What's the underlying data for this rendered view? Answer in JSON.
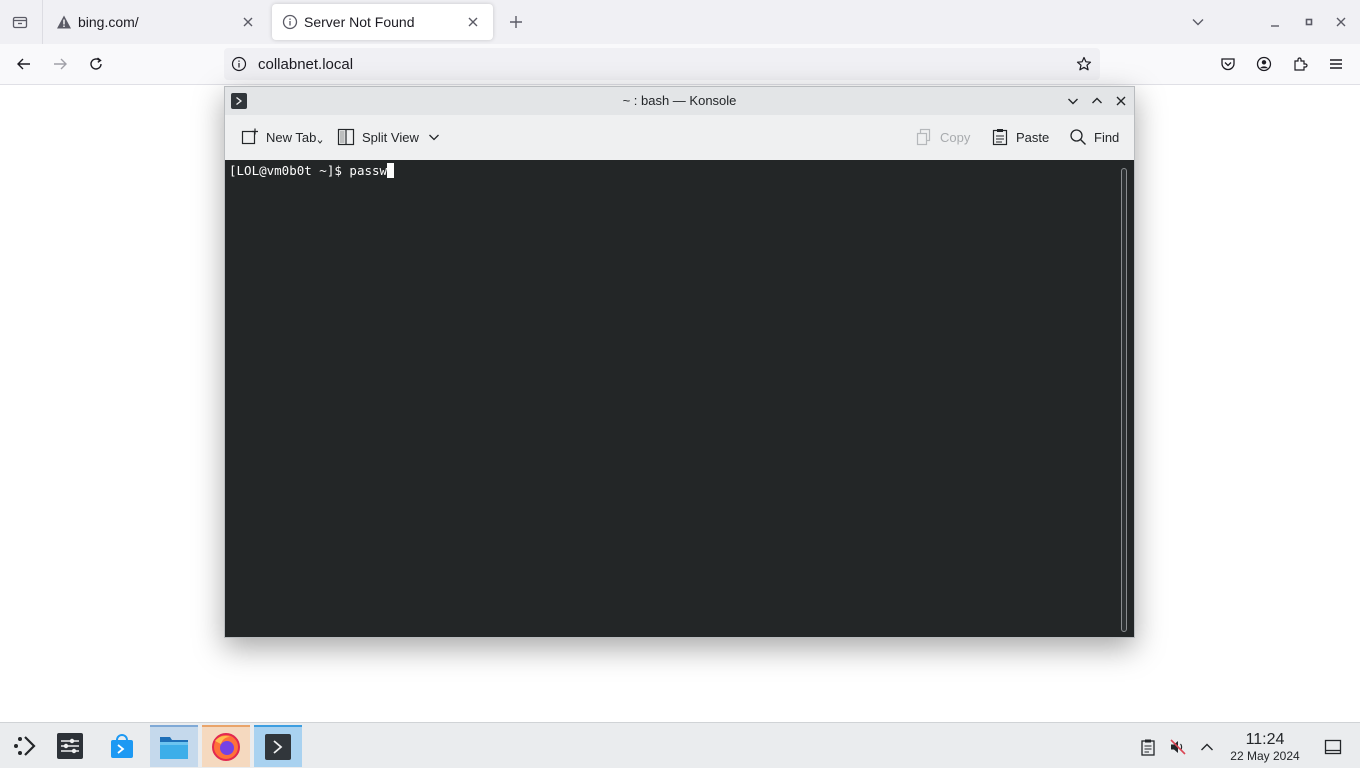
{
  "browser": {
    "tabs": [
      {
        "title": "bing.com/",
        "icon": "warning-icon",
        "active": false
      },
      {
        "title": "Server Not Found",
        "icon": "info-icon",
        "active": true
      }
    ],
    "url": "collabnet.local"
  },
  "konsole": {
    "title": "~ : bash — Konsole",
    "toolbar": {
      "new_tab": "New Tab",
      "split_view": "Split View",
      "copy": "Copy",
      "paste": "Paste",
      "find": "Find"
    },
    "terminal": {
      "prompt": "[LOL@vm0b0t ~]$ ",
      "input": "passw"
    }
  },
  "taskbar": {
    "apps": [
      "application-launcher-icon",
      "system-settings-icon",
      "discover-store-icon",
      "dolphin-files-icon",
      "firefox-icon",
      "konsole-icon"
    ],
    "clock": {
      "time": "11:24",
      "date": "22 May 2024"
    }
  },
  "colors": {
    "terminal_bg": "#232627",
    "terminal_fg": "#fcfcfc",
    "browser_tabbar": "#f0f0f4",
    "taskbar_bg": "#eaecee"
  }
}
